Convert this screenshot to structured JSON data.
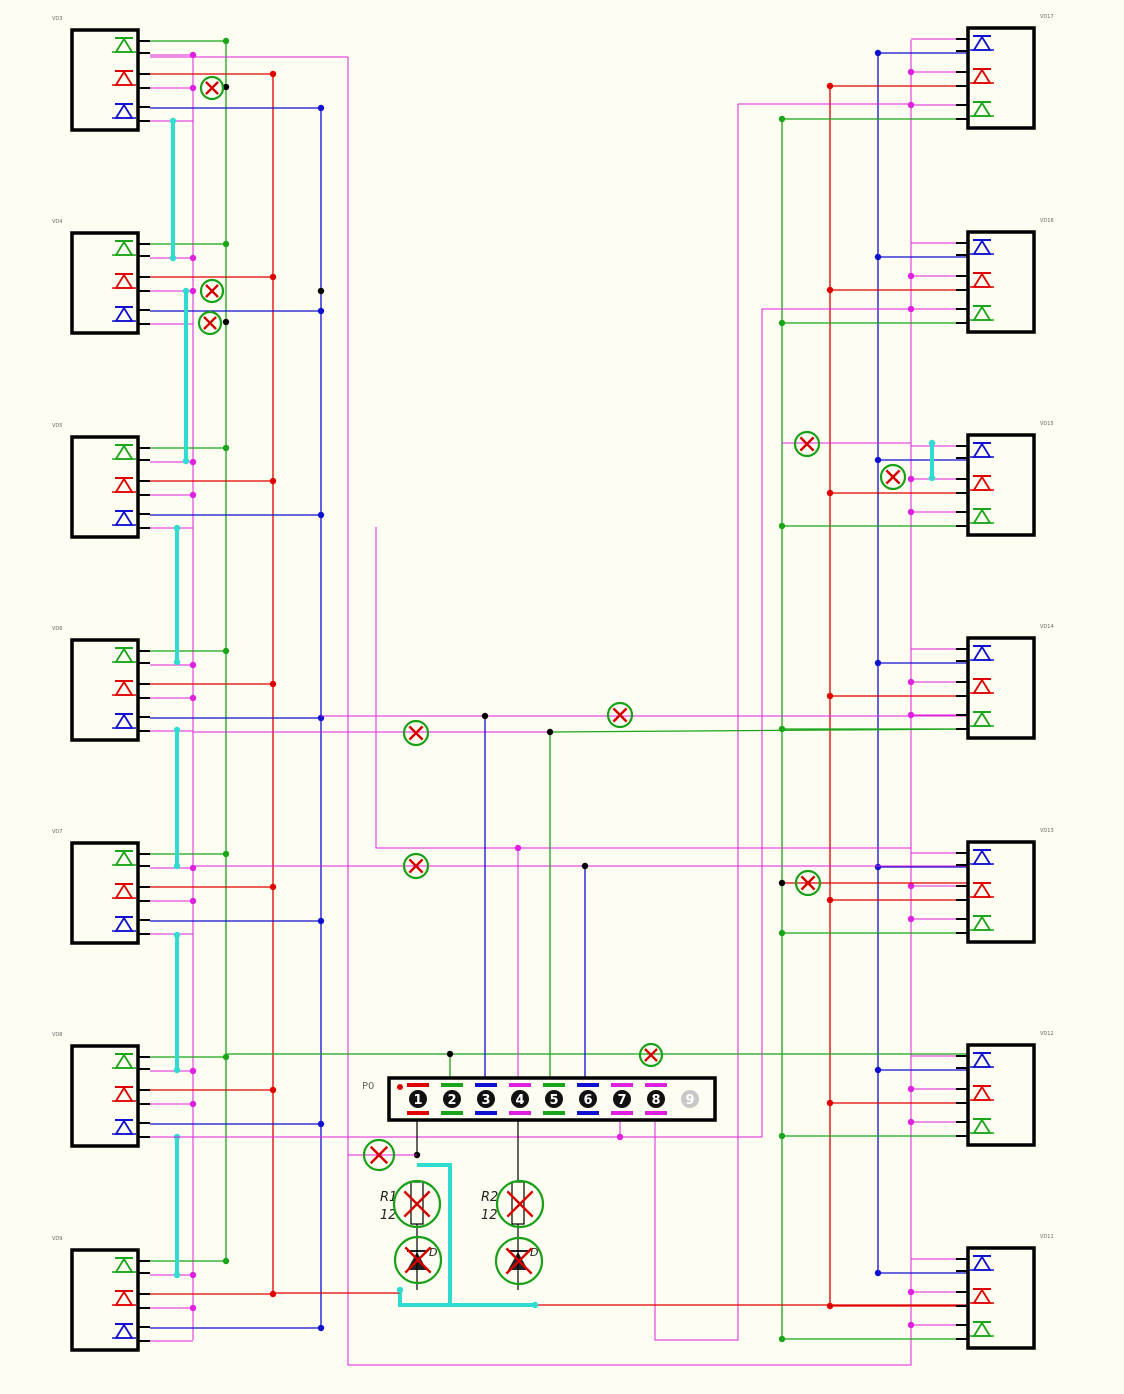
{
  "colors": {
    "background": "#fdfdf1",
    "red": "#e10000",
    "green": "#1aa51a",
    "blue": "#1010d0",
    "magenta": "#e020e0",
    "cyan": "#30dcd0",
    "black": "#000000",
    "x_mark": "#d40000",
    "x_ring": "#18a018",
    "connector_disabled": "#c8c8c8"
  },
  "left_modules": [
    {
      "label": "VD3"
    },
    {
      "label": "VD4"
    },
    {
      "label": "VD5"
    },
    {
      "label": "VD6"
    },
    {
      "label": "VD7"
    },
    {
      "label": "VD8"
    },
    {
      "label": "VD9"
    }
  ],
  "right_modules": [
    {
      "label": "VD17"
    },
    {
      "label": "VD16"
    },
    {
      "label": "VD15"
    },
    {
      "label": "VD14"
    },
    {
      "label": "VD13"
    },
    {
      "label": "VD12"
    },
    {
      "label": "VD11"
    }
  ],
  "left_led_colors": [
    "green",
    "red",
    "blue"
  ],
  "right_led_colors": [
    "blue",
    "red",
    "green"
  ],
  "connector": {
    "label": "P0",
    "pins": [
      {
        "number": "1",
        "color": "red"
      },
      {
        "number": "2",
        "color": "green"
      },
      {
        "number": "3",
        "color": "blue"
      },
      {
        "number": "4",
        "color": "magenta"
      },
      {
        "number": "5",
        "color": "green"
      },
      {
        "number": "6",
        "color": "blue"
      },
      {
        "number": "7",
        "color": "magenta"
      },
      {
        "number": "8",
        "color": "magenta"
      },
      {
        "number": "9",
        "color": "disabled"
      }
    ]
  },
  "resistors": [
    {
      "label": "R1",
      "value": "12"
    },
    {
      "label": "R2",
      "value": "12"
    }
  ],
  "diodes": [
    {
      "label": "D"
    },
    {
      "label": "D"
    }
  ]
}
